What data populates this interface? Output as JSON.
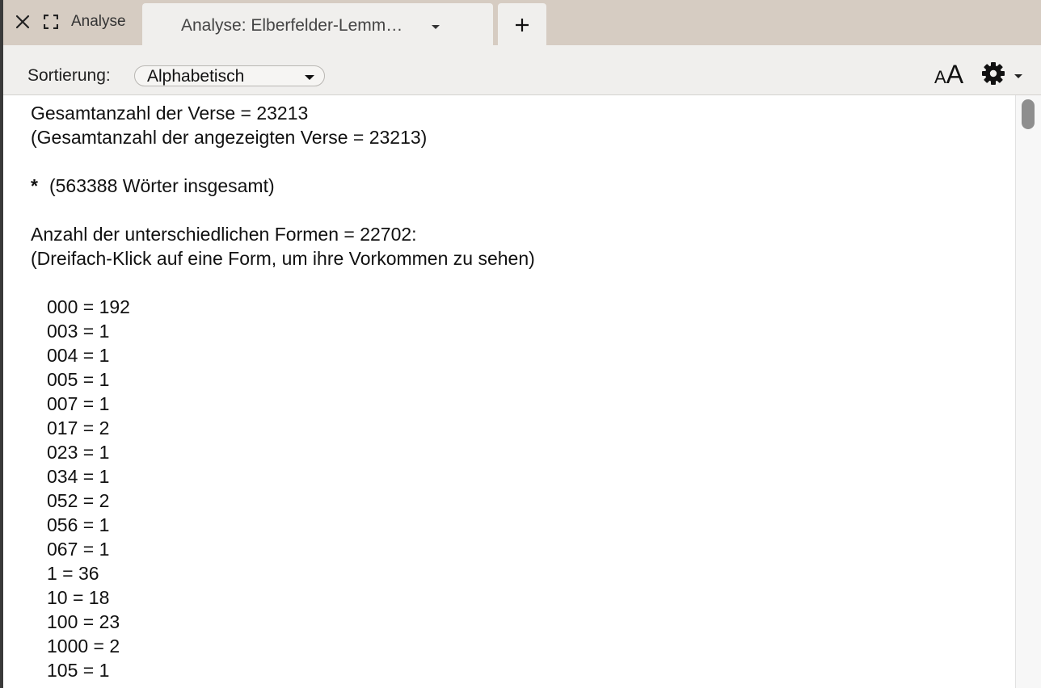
{
  "tabbar": {
    "section_label": "Analyse",
    "active_tab_title": "Analyse: Elberfelder-Lemm…"
  },
  "toolbar": {
    "sort_label": "Sortierung:",
    "sort_value": "Alphabetisch",
    "fontsize_small": "A",
    "fontsize_big": "A"
  },
  "content": {
    "total_verses": "Gesamtanzahl der Verse = 23213",
    "shown_verses": "(Gesamtanzahl der angezeigten Verse = 23213)",
    "star": "*",
    "total_words": "(563388 Wörter insgesamt)",
    "distinct_forms": "Anzahl der unterschiedlichen Formen = 22702:",
    "hint": "(Dreifach-Klick auf eine Form, um ihre Vorkommen zu sehen)",
    "entries": [
      "000 = 192",
      "003 = 1",
      "004 = 1",
      "005 = 1",
      "007 = 1",
      "017 = 2",
      "023 = 1",
      "034 = 1",
      "052 = 2",
      "056 = 1",
      "067 = 1",
      "1 = 36",
      "10 = 18",
      "100 = 23",
      "1000 = 2",
      "105 = 1"
    ]
  },
  "colors": {
    "tabbar_bg": "#d6ccc2",
    "toolbar_bg": "#f0efed",
    "content_bg": "#ffffff"
  }
}
